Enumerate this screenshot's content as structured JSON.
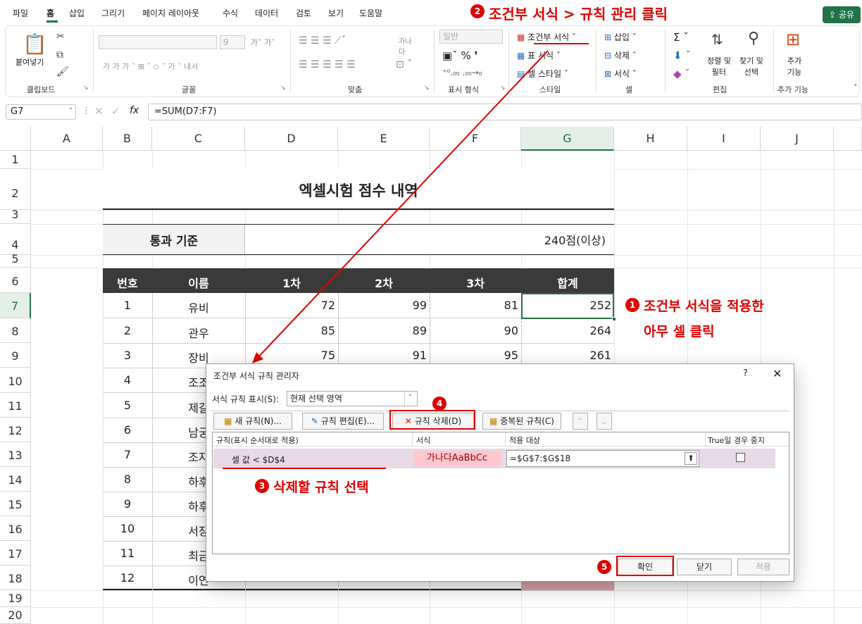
{
  "tabs": [
    "파일",
    "홈",
    "삽입",
    "그리기",
    "페이지 레이아웃",
    "수식",
    "데이터",
    "검토",
    "보기",
    "도움말"
  ],
  "share_label": "공유",
  "ribbon": {
    "clipboard_paste": "붙여넣기",
    "group_clipboard": "클립보드",
    "group_font": "글꼴",
    "group_align": "맞춤",
    "number_format": "일반",
    "group_number": "표시 형식",
    "cond_format": "조건부 서식",
    "table_format": "표 서식",
    "cell_style": "셀 스타일",
    "group_style": "스타일",
    "insert": "삽입",
    "delete": "삭제",
    "format": "서식",
    "group_cells": "셀",
    "sort_filter": "정렬 및\n필터",
    "find_select": "찾기 및\n선택",
    "group_edit": "편집",
    "addins": "추가\n기능",
    "group_addins": "추가 기능",
    "font_size": "9",
    "wrap_text": "가나\n다"
  },
  "formula_bar": {
    "name_box": "G7",
    "formula": "=SUM(D7:F7)"
  },
  "columns": [
    "A",
    "B",
    "C",
    "D",
    "E",
    "F",
    "G",
    "H",
    "I",
    "J"
  ],
  "rows": [
    "1",
    "2",
    "3",
    "4",
    "5",
    "6",
    "7",
    "8",
    "9",
    "10",
    "11",
    "12",
    "13",
    "14",
    "15",
    "16",
    "17",
    "18",
    "19",
    "20"
  ],
  "sheet": {
    "title": "엑셀시험 점수 내역",
    "pass_label": "통과 기준",
    "pass_value": "240점(이상)",
    "headers": [
      "번호",
      "이름",
      "1차",
      "2차",
      "3차",
      "합계"
    ],
    "data": [
      [
        "1",
        "유비",
        "72",
        "99",
        "81",
        "252"
      ],
      [
        "2",
        "관우",
        "85",
        "89",
        "90",
        "264"
      ],
      [
        "3",
        "장비",
        "75",
        "91",
        "95",
        "261"
      ],
      [
        "4",
        "조조",
        "",
        "",
        "",
        ""
      ],
      [
        "5",
        "제갈",
        "",
        "",
        "",
        ""
      ],
      [
        "6",
        "남궁",
        "",
        "",
        "",
        ""
      ],
      [
        "7",
        "조자",
        "",
        "",
        "",
        ""
      ],
      [
        "8",
        "하후",
        "",
        "",
        "",
        ""
      ],
      [
        "9",
        "하후",
        "",
        "",
        "",
        ""
      ],
      [
        "10",
        "서장",
        "",
        "",
        "",
        ""
      ],
      [
        "11",
        "최금",
        "",
        "",
        "",
        ""
      ],
      [
        "12",
        "이연",
        "",
        "",
        "",
        ""
      ]
    ]
  },
  "dialog": {
    "title": "조건부 서식 규칙 관리자",
    "help": "?",
    "show_rules_label": "서식 규칙 표시(S):",
    "show_rules_value": "현재 선택 영역",
    "new_rule": "새 규칙(N)...",
    "edit_rule": "규칙 편집(E)...",
    "delete_rule": "규칙 삭제(D)",
    "duplicate_rule": "중복된 규칙(C)",
    "col_rule": "규칙(표시 순서대로 적용)",
    "col_format": "서식",
    "col_applies": "적용 대상",
    "col_stop": "True일 경우 중지",
    "rule_text": "셀 값 < $D$4",
    "rule_preview": "가나다AaBbCc",
    "rule_range": "=$G$7:$G$18",
    "ok": "확인",
    "close": "닫기",
    "apply": "적용"
  },
  "annotations": {
    "a1_line1": "조건부 서식을 적용한",
    "a1_line2": "아무 셀 클릭",
    "a2": "조건부 서식 > 규칙 관리 클릭",
    "a3": "삭제할 규칙 선택",
    "n1": "1",
    "n2": "2",
    "n3": "3",
    "n4": "4",
    "n5": "5"
  },
  "colors": {
    "accent_red": "#e00000",
    "header_dark": "#3a3a3a",
    "excel_green": "#217346",
    "preview_pink": "#ffc7ce",
    "preview_text": "#9c0006"
  }
}
